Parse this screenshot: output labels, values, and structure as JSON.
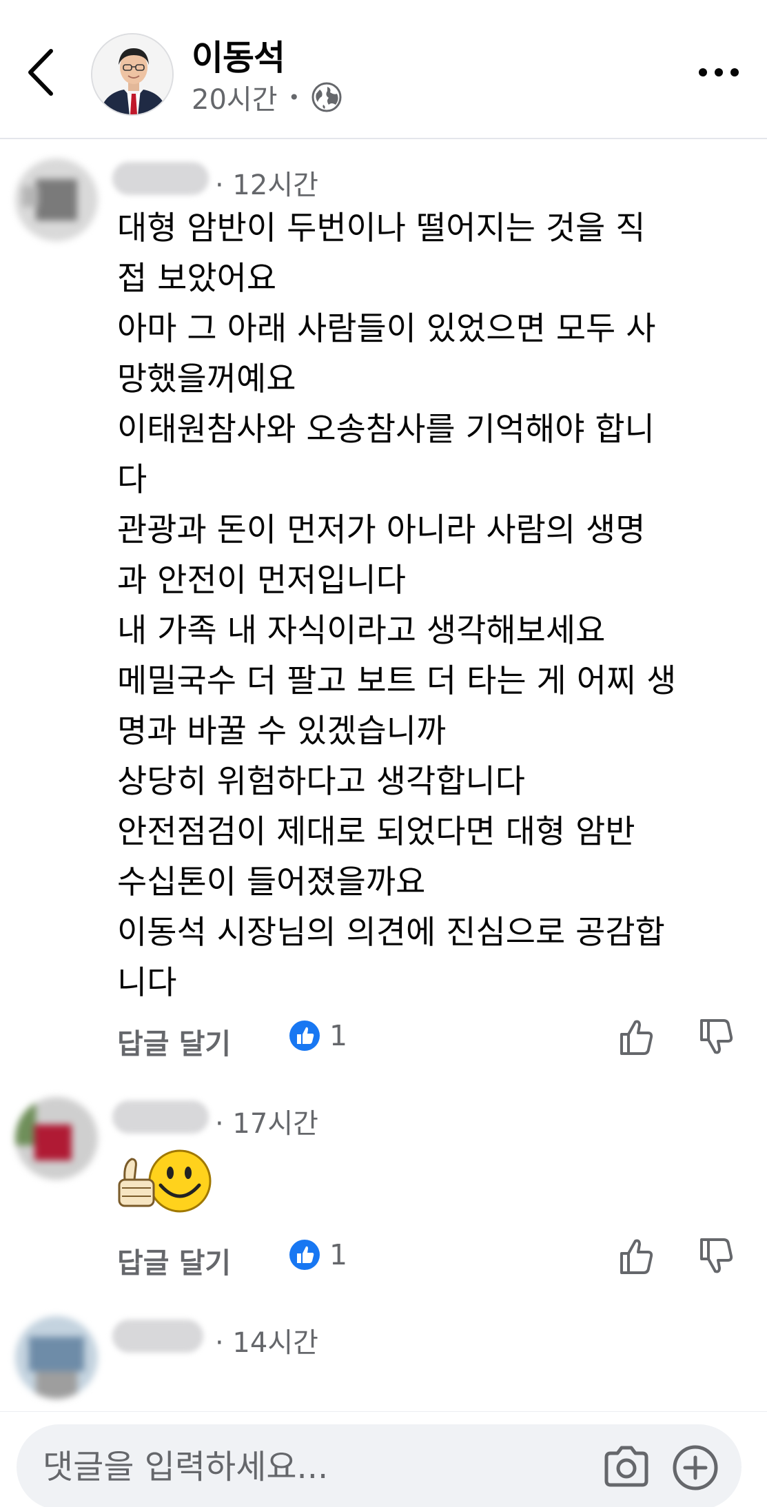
{
  "header": {
    "name": "이동석",
    "time": "20시간",
    "dot": "•"
  },
  "comments": [
    {
      "time": "· 12시간",
      "lines": [
        "대형 암반이 두번이나 떨어지는 것을 직",
        "접 보았어요",
        "아마 그 아래 사람들이 있었으면 모두 사",
        "망했을꺼예요",
        "이태원참사와 오송참사를 기억해야 합니",
        "다",
        "관광과 돈이 먼저가 아니라 사람의 생명",
        "과 안전이 먼저입니다",
        "내 가족 내 자식이라고 생각해보세요",
        "메밀국수 더 팔고 보트 더 타는 게 어찌 생",
        "명과 바꿀 수 있겠습니까",
        "상당히 위험하다고 생각합니다",
        "안전점검이 제대로 되었다면 대형 암반",
        "수십톤이 들어졌을까요",
        "이동석 시장님의 의견에 진심으로 공감합",
        "니다"
      ],
      "reply_label": "답글 달기",
      "like_count": "1"
    },
    {
      "time": "· 17시간",
      "sticker": "thumbs-up-smiley",
      "reply_label": "답글 달기",
      "like_count": "1"
    },
    {
      "time": "· 14시간"
    }
  ],
  "composer": {
    "placeholder": "댓글을 입력하세요..."
  },
  "colors": {
    "like_blue": "#1877f2",
    "secondary_text": "#65676b",
    "divider": "#e4e6eb",
    "composer_bg": "#f0f2f5"
  },
  "icons": [
    "back-arrow-icon",
    "globe-icon",
    "more-icon",
    "like-badge-icon",
    "thumbs-up-icon",
    "thumbs-down-icon",
    "camera-icon",
    "plus-circle-icon"
  ]
}
